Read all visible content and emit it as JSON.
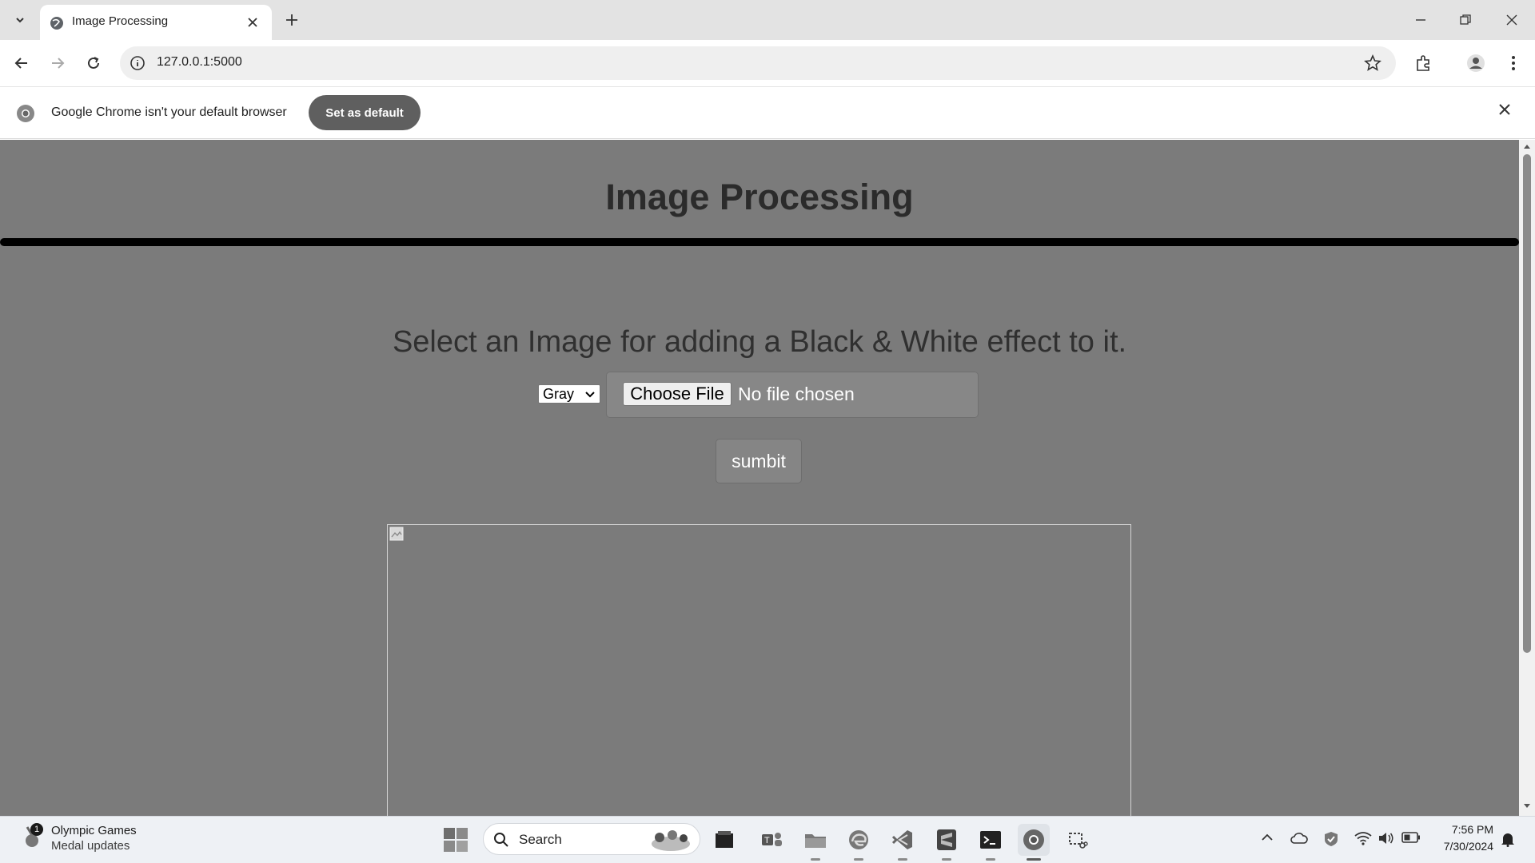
{
  "browser": {
    "tab_title": "Image Processing",
    "url": "127.0.0.1:5000",
    "infobar_text": "Google Chrome isn't your default browser",
    "infobar_button": "Set as default"
  },
  "page": {
    "title": "Image Processing",
    "instruction": "Select an Image for adding a Black & White effect to it.",
    "effect_select": {
      "selected": "Gray"
    },
    "choose_file_label": "Choose File",
    "no_file_text": "No file chosen",
    "submit_label": "sumbit"
  },
  "taskbar": {
    "widget_title": "Olympic Games",
    "widget_subtitle": "Medal updates",
    "widget_badge": "1",
    "search_placeholder": "Search",
    "apps": [
      "file-manager-icon",
      "teams-icon",
      "file-explorer-icon",
      "edge-icon",
      "vscode-icon",
      "sublime-icon",
      "terminal-icon",
      "chrome-icon",
      "snipping-tool-icon"
    ],
    "clock_time": "7:56 PM",
    "clock_date": "7/30/2024"
  },
  "colors": {
    "page_background": "#7b7b7b",
    "title_rule": "#000000",
    "set_default_button": "#5f5f5f"
  }
}
